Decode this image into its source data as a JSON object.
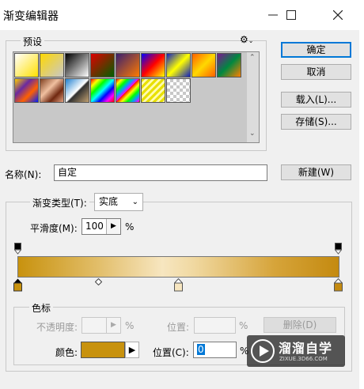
{
  "window": {
    "title": "渐变编辑器"
  },
  "presets": {
    "label": "预设",
    "swatches": [
      {
        "name": "foreground-to-background",
        "css": "linear-gradient(135deg,#ffffff 0%,#ffe000 100%)"
      },
      {
        "name": "foreground-to-transparent",
        "css": "linear-gradient(135deg,#ffd800 0%,rgba(255,216,0,0) 100%)"
      },
      {
        "name": "black-white",
        "css": "linear-gradient(135deg,#000 0%,#fff 100%)"
      },
      {
        "name": "red-green",
        "css": "linear-gradient(135deg,#e00000 0%,#006000 100%)"
      },
      {
        "name": "violet-orange",
        "css": "linear-gradient(135deg,#3a2070 0%,#ff7a00 100%)"
      },
      {
        "name": "blue-red-yellow",
        "css": "linear-gradient(135deg,#0000ff 0%,#ff0000 50%,#ffff00 100%)"
      },
      {
        "name": "blue-yellow-blue",
        "css": "linear-gradient(135deg,#1020c0 0%,#ffff00 50%,#1020c0 100%)"
      },
      {
        "name": "orange-yellow-orange",
        "css": "linear-gradient(135deg,#ff6000 0%,#ffd800 50%,#ff6000 100%)"
      },
      {
        "name": "violet-green-orange",
        "css": "linear-gradient(135deg,#7a1890 0%,#008840 50%,#ff8000 100%)"
      },
      {
        "name": "yellow-violet-orange-blue",
        "css": "linear-gradient(135deg,#ffd000 0%,#6a2aa0 35%,#ff6000 65%,#0020ff 100%)"
      },
      {
        "name": "copper",
        "css": "linear-gradient(135deg,#804020 0%,#f0c0a0 40%,#702810 70%,#e0a080 100%)"
      },
      {
        "name": "chrome",
        "css": "linear-gradient(135deg,#2080d0 0%,#ffffff 50%,#303030 55%,#c0a070 100%)"
      },
      {
        "name": "spectrum",
        "css": "linear-gradient(135deg,#ff0000,#ffff00,#00ff00,#00ffff,#0000ff,#ff00ff,#ff0000)"
      },
      {
        "name": "transparent-rainbow",
        "css": "repeating-linear-gradient(135deg,#ff0000 0px,#ffff00 5px,#00ff00 10px,#00a0ff 15px,#ff00ff 20px)"
      },
      {
        "name": "transparent-stripes",
        "css": "repeating-linear-gradient(135deg,#e8e000 0px,#e8e000 3px,#fffbb0 3px,#fffbb0 6px)"
      },
      {
        "name": "neutral-density",
        "css": "checker"
      }
    ]
  },
  "actions": {
    "ok": "确定",
    "cancel": "取消",
    "load": "载入(L)...",
    "save": "存储(S)...",
    "new": "新建(W)"
  },
  "name_field": {
    "label": "名称(N):",
    "value": "自定"
  },
  "gradient": {
    "type_label": "渐变类型(T):",
    "type_value": "实底",
    "smoothness_label": "平滑度(M):",
    "smoothness_value": "100",
    "smoothness_unit": "%",
    "preview_css": "linear-gradient(to right,#c8920e 0%,#e2be6a 25%,#f7e6c0 45%,#f0d8a0 55%,#d6a43a 80%,#c48a10 100%)"
  },
  "color_stops": {
    "label": "色标",
    "opacity_label": "不透明度:",
    "opacity_unit": "%",
    "location_label": "位置:",
    "location_unit": "%",
    "delete_label": "删除(D)",
    "color_label": "颜色:",
    "color_swatch": "#c8920e",
    "color_location_label": "位置(C):",
    "color_location_value": "0",
    "color_location_unit": "%"
  },
  "watermark": {
    "brand": "溜溜自学",
    "url": "ZIXUE.3D66.COM"
  }
}
